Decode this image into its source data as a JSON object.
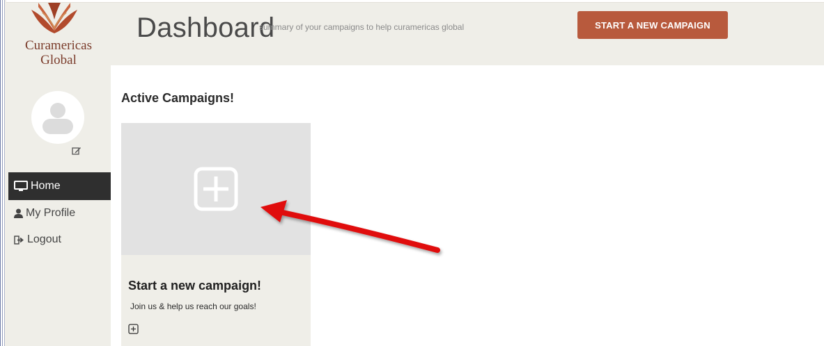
{
  "brand": {
    "line1": "Curamericas",
    "line2": "Global",
    "color": "#7a3b2a"
  },
  "header": {
    "title": "Dashboard",
    "subtitle": "summary of your campaigns to help curamericas global",
    "cta_label": "START A NEW CAMPAIGN",
    "cta_color": "#b85a3d"
  },
  "sidebar": {
    "avatar_icon": "user-avatar-icon",
    "edit_icon": "edit-icon",
    "items": [
      {
        "label": "Home",
        "icon": "monitor-icon",
        "active": true
      },
      {
        "label": "My Profile",
        "icon": "user-icon",
        "active": false
      },
      {
        "label": "Logout",
        "icon": "sign-out-icon",
        "active": false
      }
    ]
  },
  "main": {
    "section_title": "Active Campaigns!",
    "card": {
      "title": "Start a new campaign!",
      "text": "Join us & help us reach our goals!",
      "icon": "plus-square-icon"
    }
  },
  "annotation": {
    "arrow_color": "#e01010"
  }
}
